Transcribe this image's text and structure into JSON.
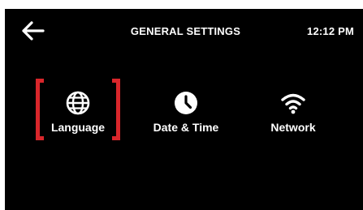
{
  "header": {
    "back_icon": "arrow-left-icon",
    "title": "GENERAL SETTINGS",
    "time": "12:12 PM"
  },
  "menu": {
    "selected": "language",
    "accent_color": "#d9262b",
    "items": [
      {
        "id": "language",
        "label": "Language",
        "icon": "globe-icon"
      },
      {
        "id": "date-time",
        "label": "Date & Time",
        "icon": "clock-icon"
      },
      {
        "id": "network",
        "label": "Network",
        "icon": "wifi-icon"
      }
    ]
  }
}
